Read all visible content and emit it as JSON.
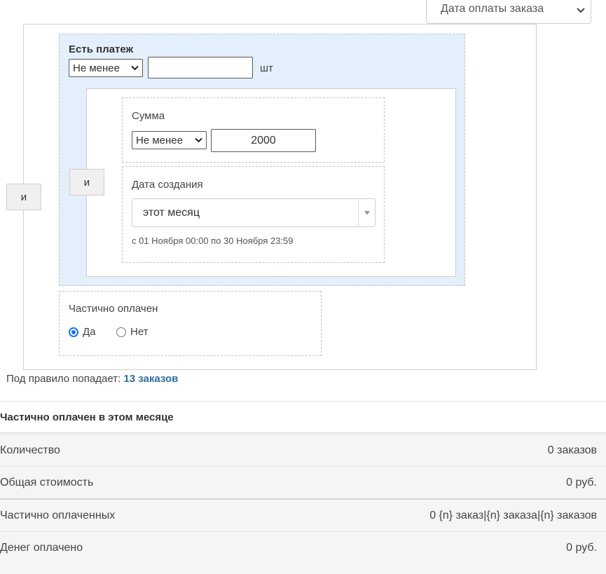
{
  "top_select": {
    "value": "Дата оплаты заказа"
  },
  "outer_group": {
    "operator_label": "и"
  },
  "payment_group": {
    "title": "Есть платеж",
    "count_operator": "Не менее",
    "count_value": "",
    "count_unit": "шт",
    "inner_operator_label": "и",
    "sum": {
      "label": "Сумма",
      "operator": "Не менее",
      "value": "2000"
    },
    "created_date": {
      "label": "Дата создания",
      "value": "этот месяц",
      "range_text": "с 01 Ноября 00:00 по 30 Ноября 23:59"
    }
  },
  "partially_paid": {
    "label": "Частично оплачен",
    "options": [
      {
        "label": "Да",
        "selected": true
      },
      {
        "label": "Нет",
        "selected": false
      }
    ]
  },
  "rule_summary": {
    "prefix": "Под правило попадает:",
    "link": "13 заказов"
  },
  "stats": {
    "title": "Частично оплачен в этом месяце",
    "rows": [
      {
        "label": "Количество",
        "value": "0 заказов"
      },
      {
        "label": "Общая стоимость",
        "value": "0 руб."
      },
      {
        "label": "Частично оплаченных",
        "value": "0 {n} заказ|{n} заказа|{n} заказов"
      },
      {
        "label": "Денег оплачено",
        "value": "0 руб."
      }
    ]
  },
  "colors": {
    "group_bg": "#e3effb",
    "link": "#2f6f9f",
    "radio_accent": "#1a73e8"
  }
}
